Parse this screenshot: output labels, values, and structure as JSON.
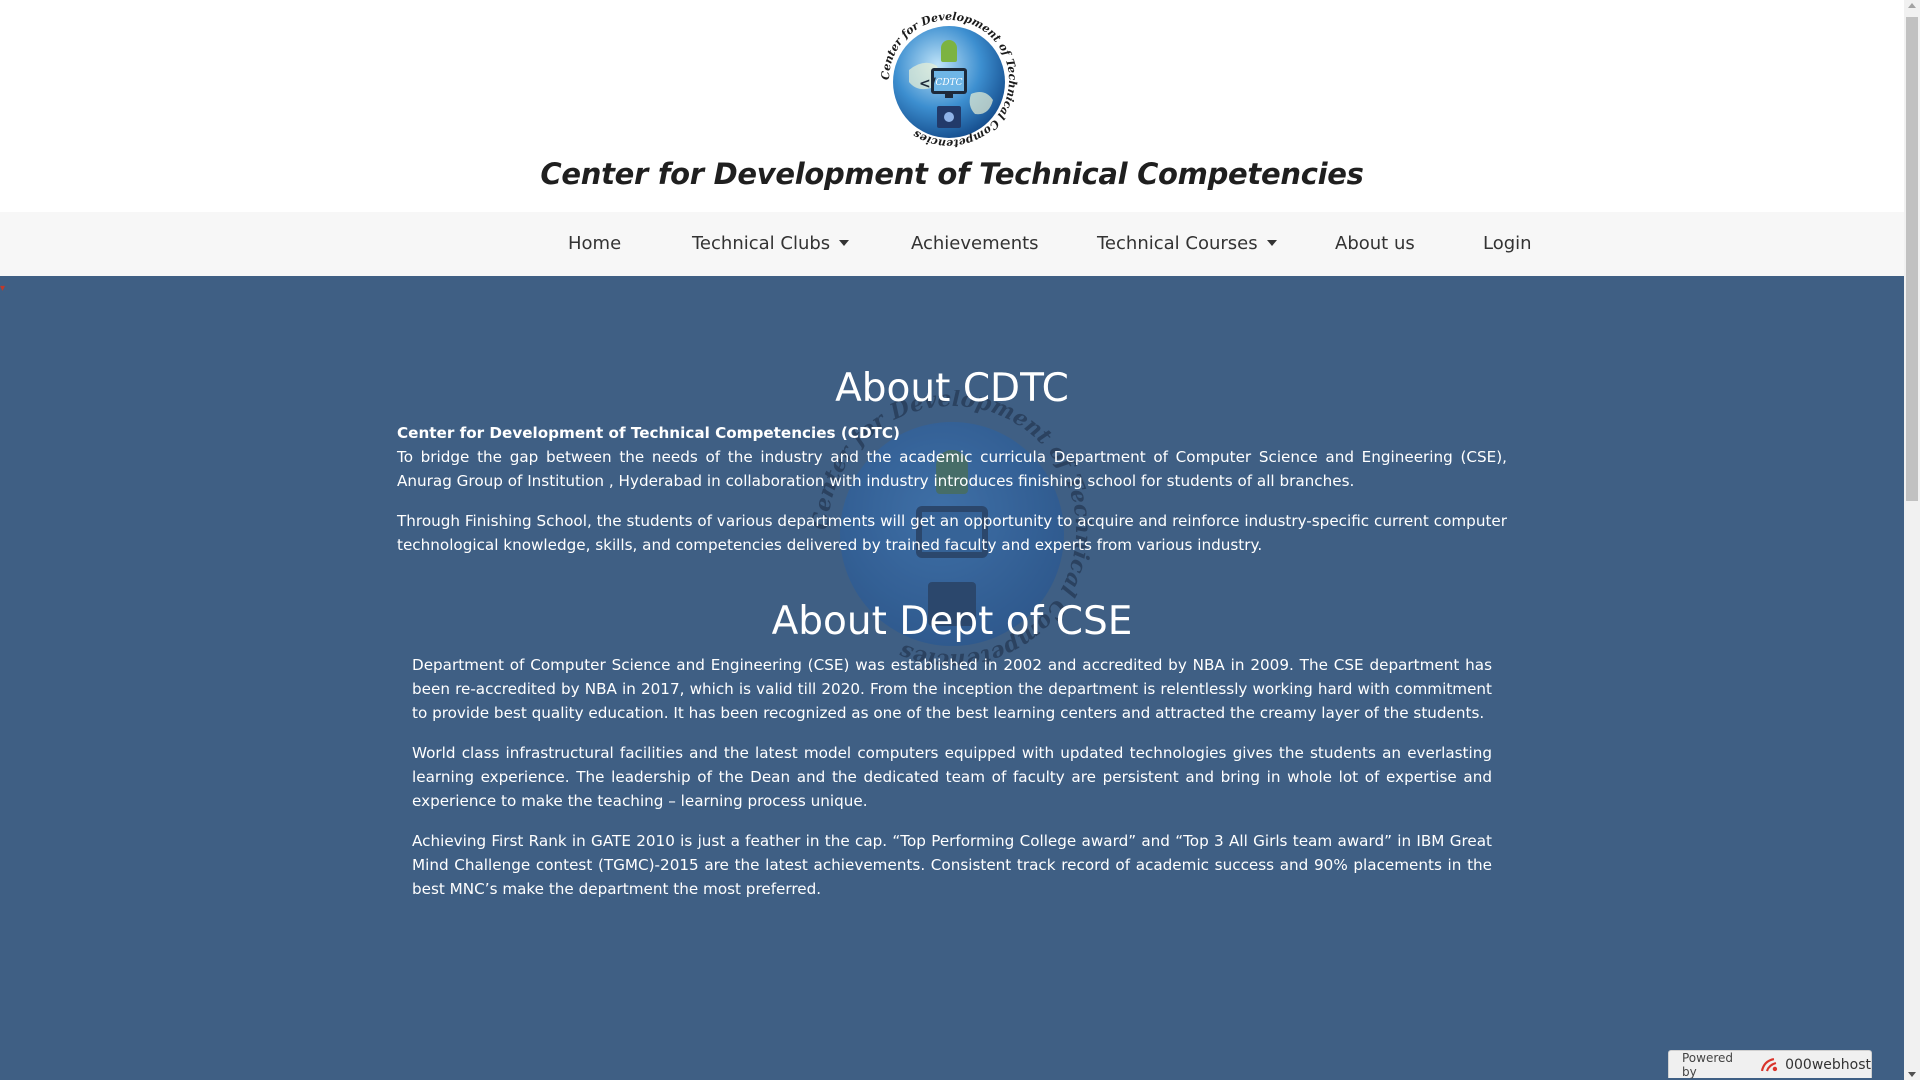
{
  "header": {
    "logo_text": "CDTC",
    "logo_ring_text": "Center for Development of Technical Competencies",
    "title": "Center for Development of Technical Competencies"
  },
  "nav": {
    "items": [
      {
        "label": "Home",
        "dropdown": false
      },
      {
        "label": "Technical Clubs",
        "dropdown": true
      },
      {
        "label": "Achievements",
        "dropdown": false
      },
      {
        "label": "Technical Courses",
        "dropdown": true
      },
      {
        "label": "About us",
        "dropdown": false
      },
      {
        "label": "Login",
        "dropdown": false
      }
    ]
  },
  "about_cdtc": {
    "heading": "About CDTC",
    "lead": "Center for Development of Technical Competencies (CDTC)",
    "p1": "To bridge the gap between the needs of the industry and the academic curricula Department of Computer Science and Engineering (CSE), Anurag Group of Institution , Hyderabad in collaboration with industry introduces finishing school for students of all branches.",
    "p2": "Through Finishing School, the students of various departments will get an opportunity to acquire and reinforce industry-specific current computer technological knowledge, skills, and competencies delivered by trained faculty and experts from various industry."
  },
  "about_cse": {
    "heading": "About Dept of CSE",
    "p1": "Department of Computer Science and Engineering (CSE) was established in 2002 and accredited by NBA in 2009. The CSE department has been re-accredited by NBA in 2017, which is valid till 2020. From the inception the department is relentlessly working hard with commitment to provide best quality education. It has been recognized as one of the best learning centers and attracted the creamy layer of the students.",
    "p2": "World class infrastructural facilities and the latest model computers equipped with updated technologies gives the students an everlasting learning experience. The leadership of the Dean and the dedicated team of faculty are persistent and bring in whole lot of expertise and experience to make the teaching – learning process unique.",
    "p3": "Achieving First Rank in GATE 2010 is just a feather in the cap. “Top Performing College award” and “Top 3 All Girls team award” in IBM Great Mind Challenge contest (TGMC)-2015 are the latest achievements. Consistent track record of academic success and 90% placements in the best MNC’s make the department the most preferred."
  },
  "badge": {
    "prefix": "Powered by",
    "host": "000webhost"
  },
  "colors": {
    "content_bg": "#3f5f84",
    "navbar_bg": "#f7f7f7",
    "text_light": "#ffffff",
    "badge_accent": "#d9342b"
  }
}
